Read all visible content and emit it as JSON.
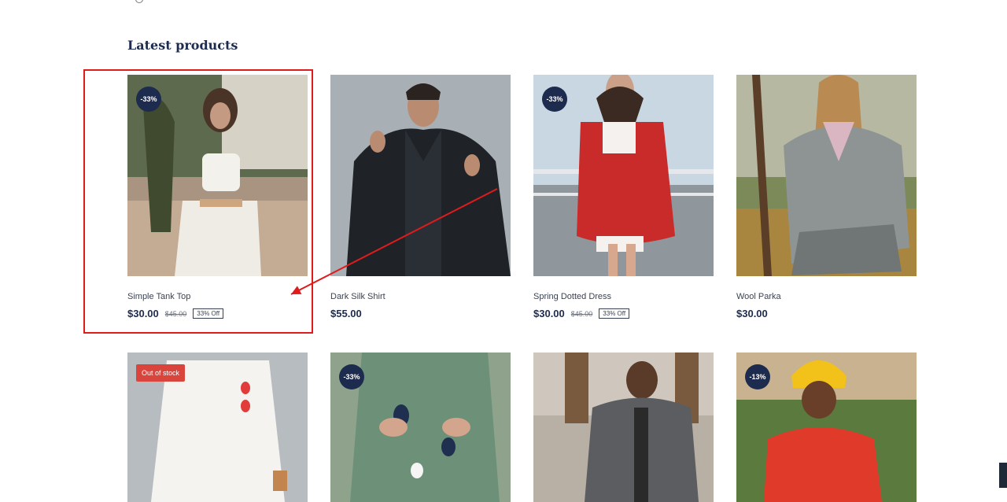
{
  "section": {
    "title": "Latest products"
  },
  "products_row1": [
    {
      "name": "Simple Tank Top",
      "price": "$30.00",
      "old_price": "$45.00",
      "discount": "33% Off",
      "badge": "-33%"
    },
    {
      "name": "Dark Silk Shirt",
      "price": "$55.00"
    },
    {
      "name": "Spring Dotted Dress",
      "price": "$30.00",
      "old_price": "$45.00",
      "discount": "33% Off",
      "badge": "-33%"
    },
    {
      "name": "Wool Parka",
      "price": "$30.00"
    }
  ],
  "products_row2": [
    {
      "badge": "Out of stock"
    },
    {
      "badge": "-33%"
    },
    {},
    {
      "badge": "-13%"
    }
  ],
  "colors": {
    "brand_navy": "#1d2b4f",
    "sale_red": "#d9443d",
    "annotation_red": "#e01b1b"
  }
}
